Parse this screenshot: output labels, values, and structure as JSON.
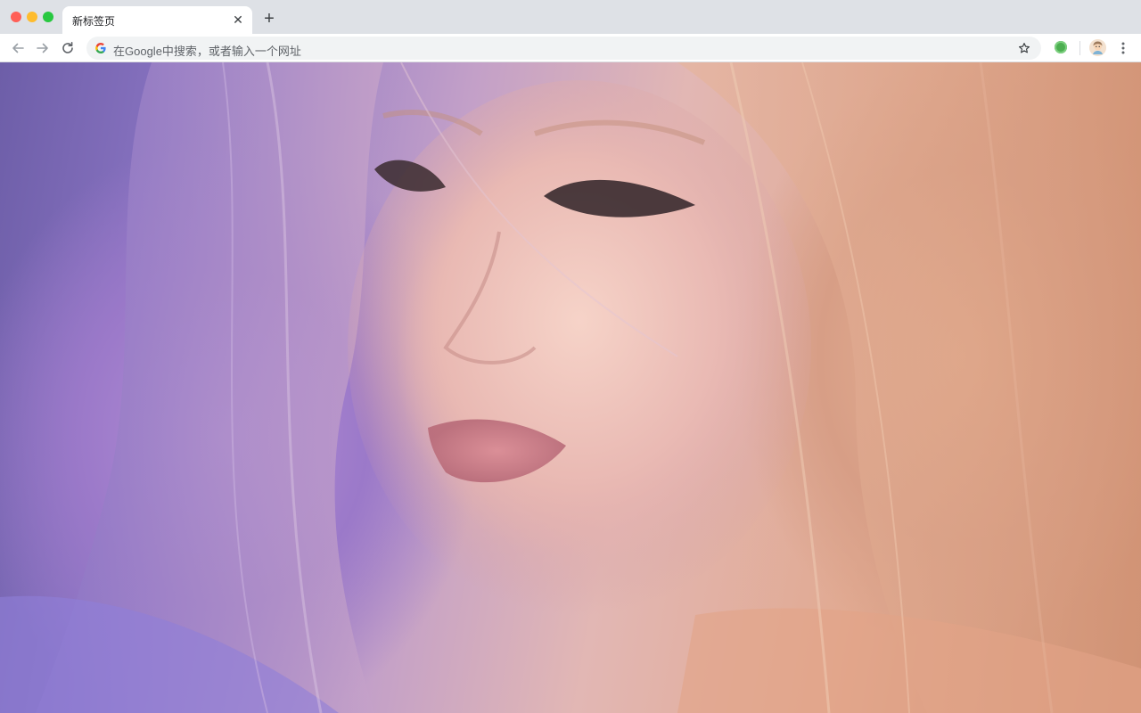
{
  "window": {
    "traffic_lights": {
      "close_color": "#ff5f57",
      "minimize_color": "#febc2e",
      "maximize_color": "#28c840"
    }
  },
  "tabs": [
    {
      "title": "新标签页",
      "active": true
    }
  ],
  "toolbar": {
    "back_icon": "arrow-left-icon",
    "forward_icon": "arrow-right-icon",
    "reload_icon": "reload-icon",
    "omnibox": {
      "placeholder": "在Google中搜索，或者输入一个网址",
      "search_engine_icon": "google-g-icon"
    },
    "bookmark_icon": "star-icon",
    "extension_icon": "green-circle-extension-icon",
    "profile_icon": "avatar-icon",
    "menu_icon": "more-vertical-icon"
  },
  "content": {
    "type": "wallpaper-photo",
    "accent_colors": [
      "#7b68b8",
      "#e6b2ae",
      "#d89b7f"
    ]
  },
  "new_tab_symbol": "+",
  "close_symbol": "✕"
}
